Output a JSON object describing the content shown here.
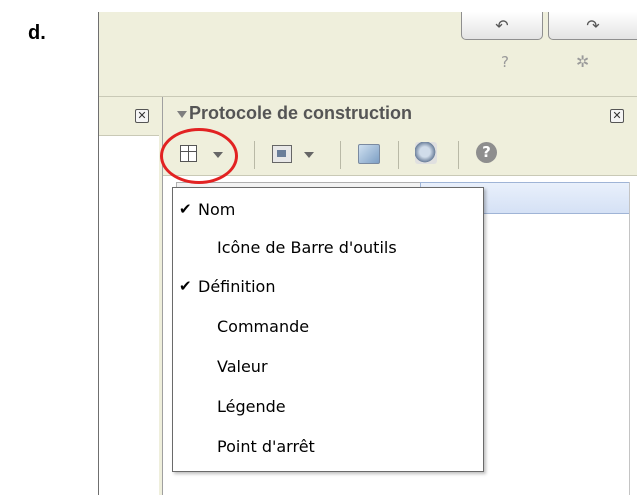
{
  "step_label": "d.",
  "window": {
    "undo_glyph": "↶",
    "redo_glyph": "↷",
    "help_glyph": "?",
    "settings_glyph": "✲"
  },
  "left_panel": {
    "close_glyph": "✕"
  },
  "panel": {
    "title": "Protocole de construction",
    "close_glyph": "✕",
    "toolbar": {
      "columns_button_icon": "columns-icon",
      "export_button_icon": "export-icon",
      "navigation_icon": "navigation-bar-icon",
      "zoom_icon": "zoom-icon",
      "help_glyph": "?"
    }
  },
  "menu": {
    "items": [
      {
        "label": "Nom",
        "checked": true
      },
      {
        "label": "Icône de Barre d'outils",
        "checked": false
      },
      {
        "label": "Définition",
        "checked": true
      },
      {
        "label": "Commande",
        "checked": false
      },
      {
        "label": "Valeur",
        "checked": false
      },
      {
        "label": "Légende",
        "checked": false
      },
      {
        "label": "Point d'arrêt",
        "checked": false
      }
    ],
    "check_glyph": "✔"
  },
  "colors": {
    "toolbar_bg": "#efefdc",
    "highlight": "#e22222"
  }
}
